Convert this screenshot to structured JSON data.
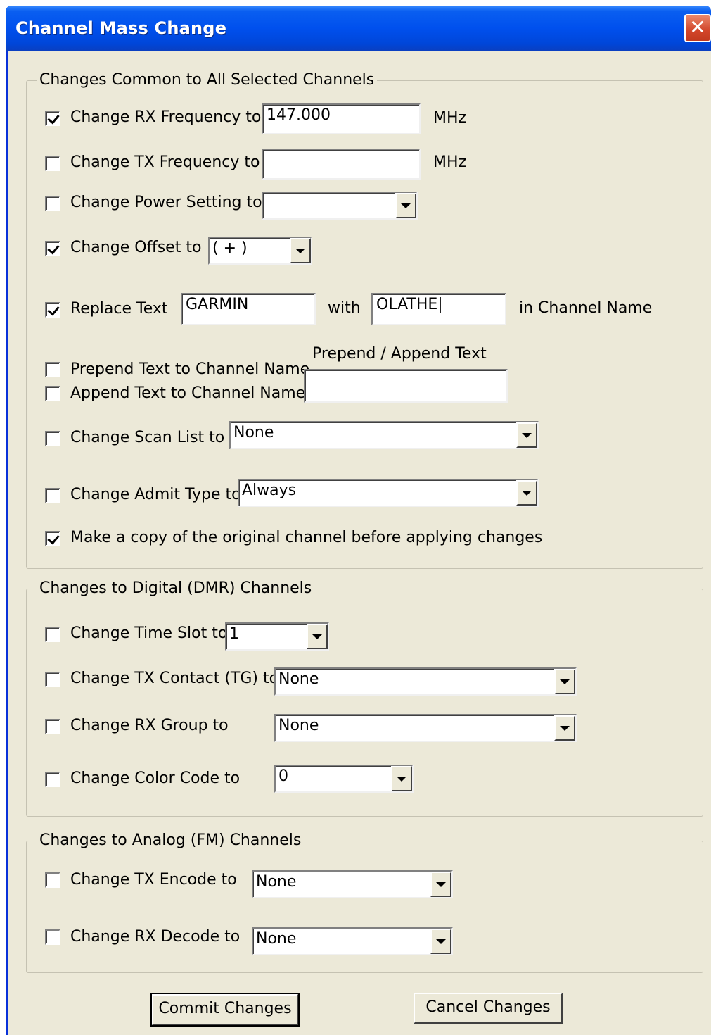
{
  "window": {
    "title": "Channel Mass Change",
    "close_glyph": "✕"
  },
  "common": {
    "legend": "Changes Common to All Selected Channels",
    "rx_freq": {
      "label": "Change RX Frequency to",
      "checked": true,
      "value": "147.000",
      "unit": "MHz"
    },
    "tx_freq": {
      "label": "Change TX Frequency to",
      "checked": false,
      "value": "",
      "unit": "MHz"
    },
    "power": {
      "label": "Change Power Setting to",
      "checked": false,
      "value": ""
    },
    "offset": {
      "label": "Change Offset to",
      "checked": true,
      "value": "( + )"
    },
    "replace": {
      "label": "Replace Text",
      "checked": true,
      "find": "GARMIN",
      "with_label": "with",
      "replace": "OLATHE|",
      "suffix": "in Channel Name"
    },
    "prepend_append_label": "Prepend / Append Text",
    "prepend": {
      "label": "Prepend Text to Channel Name",
      "checked": false
    },
    "append": {
      "label": "Append Text to Channel Name",
      "checked": false
    },
    "pa_value": "",
    "scan_list": {
      "label": "Change Scan List to",
      "checked": false,
      "value": "None"
    },
    "admit": {
      "label": "Change Admit Type to",
      "checked": false,
      "value": "Always"
    },
    "copy": {
      "label": "Make a copy of the original channel before applying changes",
      "checked": true
    }
  },
  "digital": {
    "legend": "Changes to Digital (DMR) Channels",
    "time_slot": {
      "label": "Change Time Slot to",
      "checked": false,
      "value": "1"
    },
    "tx_contact": {
      "label": "Change TX Contact (TG) to",
      "checked": false,
      "value": "None"
    },
    "rx_group": {
      "label": "Change RX Group to",
      "checked": false,
      "value": "None"
    },
    "color_code": {
      "label": "Change Color Code to",
      "checked": false,
      "value": "0"
    }
  },
  "analog": {
    "legend": "Changes to Analog (FM) Channels",
    "tx_encode": {
      "label": "Change TX Encode to",
      "checked": false,
      "value": "None"
    },
    "rx_decode": {
      "label": "Change RX Decode to",
      "checked": false,
      "value": "None"
    }
  },
  "buttons": {
    "commit": "Commit Changes",
    "cancel": "Cancel Changes"
  }
}
